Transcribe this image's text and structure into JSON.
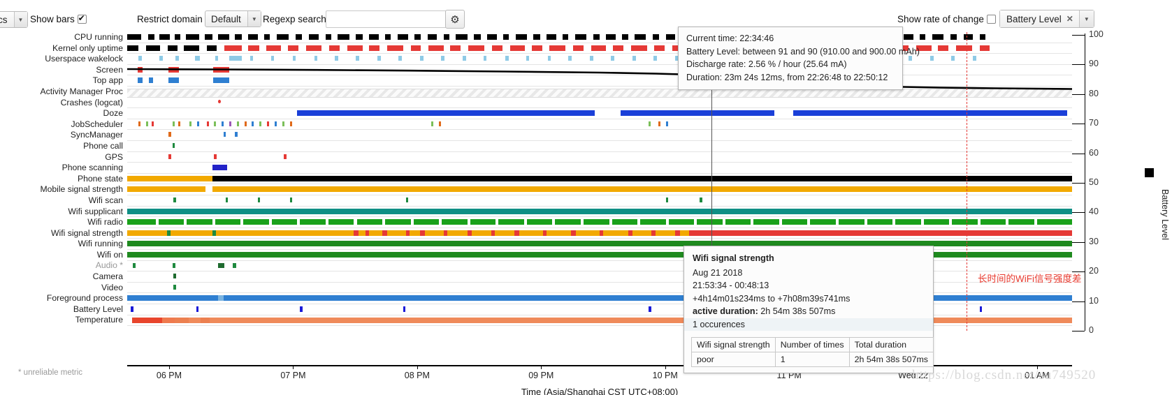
{
  "toolbar": {
    "left_select_value": "cs",
    "show_bars_label": "Show bars",
    "show_bars_checked": true,
    "restrict_domain_label": "Restrict domain",
    "restrict_domain_value": "Default",
    "regexp_search_label": "Regexp search",
    "regexp_search_value": "",
    "regexp_search_placeholder": "",
    "gear_icon": "gear-icon",
    "show_rate_label": "Show rate of change",
    "show_rate_checked": false,
    "metric_token": "Battery Level",
    "metric_remove_icon": "close-icon",
    "dropdown_icon": "chevron-down-icon"
  },
  "chart_data": {
    "type": "timeline",
    "title": "",
    "xlabel": "Time (Asia/Shanghai CST UTC+08:00)",
    "ylabel": "Battery Level",
    "xticks": [
      "06 PM",
      "07 PM",
      "08 PM",
      "09 PM",
      "10 PM",
      "11 PM",
      "Wed 22",
      "01 AM"
    ],
    "yticks": [
      100,
      90,
      80,
      70,
      60,
      50,
      40,
      30,
      20,
      10,
      0
    ],
    "ylim": [
      0,
      100
    ],
    "legend": [
      "Battery Level"
    ],
    "unreliable_note": "* unreliable metric",
    "rows": [
      {
        "label": "CPU running",
        "color": "#000000"
      },
      {
        "label": "Kernel only uptime",
        "color": "#e53935"
      },
      {
        "label": "Userspace wakelock",
        "color": "#8ecae6"
      },
      {
        "label": "Screen",
        "color": "#e53935"
      },
      {
        "label": "Top app",
        "color": "#2f7fd1"
      },
      {
        "label": "Activity Manager Proc",
        "color": "#dcdcdc"
      },
      {
        "label": "Crashes (logcat)",
        "color": "#e53935"
      },
      {
        "label": "Doze",
        "color": "#1a3fd8"
      },
      {
        "label": "JobScheduler",
        "color": "#7bbf5a"
      },
      {
        "label": "SyncManager",
        "color": "#e53935"
      },
      {
        "label": "Phone call",
        "color": "#1f8a3f"
      },
      {
        "label": "GPS",
        "color": "#e53935"
      },
      {
        "label": "Phone scanning",
        "color": "#2323c8"
      },
      {
        "label": "Phone state",
        "color": "#000000"
      },
      {
        "label": "Mobile signal strength",
        "color": "#f2a900"
      },
      {
        "label": "Wifi scan",
        "color": "#1f8a3f"
      },
      {
        "label": "Wifi supplicant",
        "color": "#0f8f85"
      },
      {
        "label": "Wifi radio",
        "color": "#1aa11a"
      },
      {
        "label": "Wifi signal strength",
        "color": "#e53935"
      },
      {
        "label": "Wifi running",
        "color": "#1f8a1f"
      },
      {
        "label": "Wifi on",
        "color": "#1f8a1f"
      },
      {
        "label": "Audio *",
        "color": "#1f8a3f",
        "dim": true
      },
      {
        "label": "Camera",
        "color": "#1f6b2f"
      },
      {
        "label": "Video",
        "color": "#1f8a3f"
      },
      {
        "label": "Foreground process",
        "color": "#2f7fd1"
      },
      {
        "label": "Battery Level",
        "color": "#1a1ad8"
      },
      {
        "label": "Temperature",
        "color": "#e8743b"
      }
    ]
  },
  "tooltip_top": {
    "lines": [
      "Current time: 22:34:46",
      "Battery Level: between 91 and 90 (910.00 and 900.00 mAh)",
      "Discharge rate: 2.56 % / hour (25.64 mA)",
      "Duration: 23m 24s 12ms, from 22:26:48 to 22:50:12"
    ]
  },
  "tooltip_bottom": {
    "title": "Wifi signal strength",
    "date": "Aug 21 2018",
    "time_range": "21:53:34 - 00:48:13",
    "offset_range": "+4h14m01s234ms to +7h08m39s741ms",
    "active_duration_label": "active duration:",
    "active_duration_value": "2h 54m 38s 507ms",
    "occurrences": "1 occurences",
    "table": {
      "headers": [
        "Wifi signal strength",
        "Number of times",
        "Total duration"
      ],
      "rows": [
        [
          "poor",
          "1",
          "2h 54m 38s 507ms"
        ]
      ]
    }
  },
  "annotation": {
    "text": "长时间的WiFi信号强度差",
    "color": "#e8392e"
  },
  "watermark": "https://blog.csdn.net/su749520"
}
